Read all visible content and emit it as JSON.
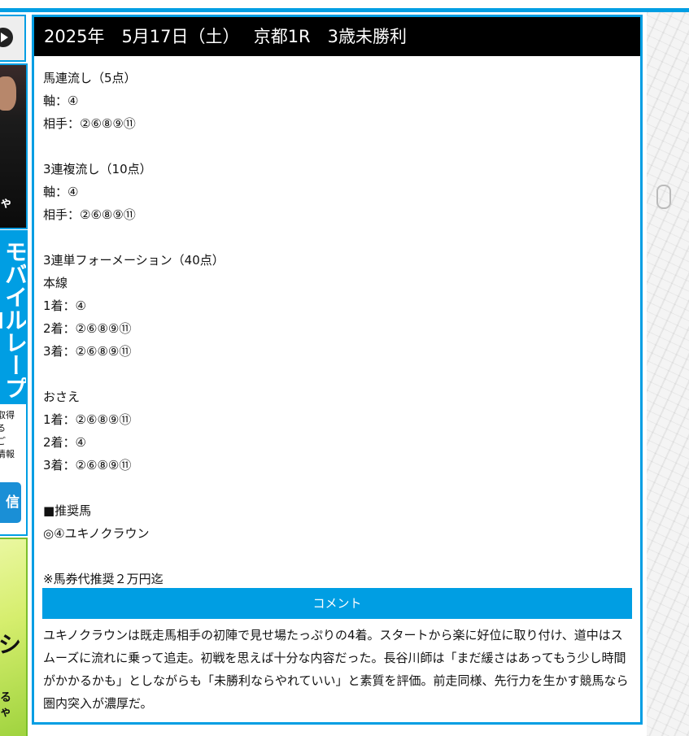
{
  "header": {
    "title": "2025年　5月17日（土）　 京都1R　3歳未勝利"
  },
  "picks": {
    "lines": [
      "馬連流し（5点）",
      "軸：④",
      "相手：②⑥⑧⑨⑪",
      "",
      "3連複流し（10点）",
      "軸：④",
      "相手：②⑥⑧⑨⑪",
      "",
      "3連単フォーメーション（40点）",
      "本線",
      "1着：④",
      "2着：②⑥⑧⑨⑪",
      "3着：②⑥⑧⑨⑪",
      "",
      "おさえ",
      "1着：②⑥⑧⑨⑪",
      "2着：④",
      "3着：②⑥⑧⑨⑪",
      "",
      "■推奨馬",
      "◎④ユキノクラウン",
      "",
      "※馬券代推奨２万円迄"
    ]
  },
  "comment": {
    "label": "コメント",
    "text": "ユキノクラウンは既走馬相手の初陣で見せ場たっぷりの4着。スタートから楽に好位に取り付け、道中はスムーズに流れに乗って追走。初戦を思えば十分な内容だった。長谷川師は「まだ緩さはあってもう少し時間がかかるかも」としながらも「未勝利ならやれていい」と素質を評価。前走同様、先行力を生かす競馬なら圏内突入が濃厚だ。"
  },
  "sidebar": {
    "photo_text": "ゃ",
    "promo_title": "モバイルレープロ",
    "promo_small": [
      "取得",
      "る",
      "ご",
      "情報"
    ],
    "promo_button": "信",
    "green_text1": "シ",
    "green_text2": [
      "る",
      "ゃ"
    ]
  },
  "colors": {
    "accent": "#009ee3",
    "header_bg": "#000000"
  }
}
